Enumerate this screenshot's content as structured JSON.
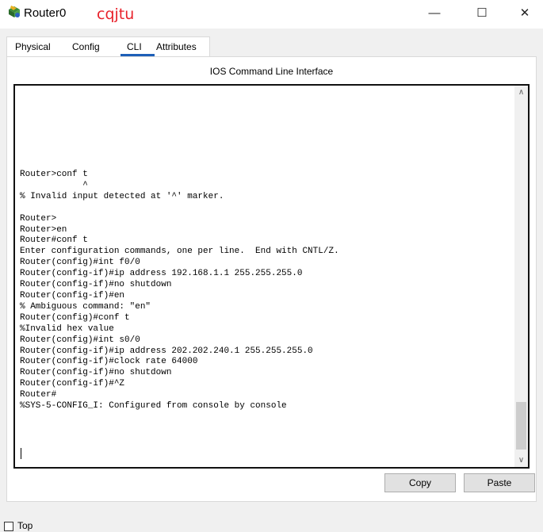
{
  "window": {
    "title": "Router0",
    "watermark": "cqjtu",
    "minimize_glyph": "—",
    "maximize_glyph": "☐",
    "close_glyph": "✕"
  },
  "tabs": [
    {
      "label": "Physical",
      "active": false
    },
    {
      "label": "Config",
      "active": false
    },
    {
      "label": "CLI",
      "active": true
    },
    {
      "label": "Attributes",
      "active": false
    }
  ],
  "cli": {
    "header": "IOS Command Line Interface",
    "output": "Router>conf t\n            ^\n% Invalid input detected at '^' marker.\n\nRouter>\nRouter>en\nRouter#conf t\nEnter configuration commands, one per line.  End with CNTL/Z.\nRouter(config)#int f0/0\nRouter(config-if)#ip address 192.168.1.1 255.255.255.0\nRouter(config-if)#no shutdown\nRouter(config-if)#en\n% Ambiguous command: \"en\"\nRouter(config)#conf t\n%Invalid hex value\nRouter(config)#int s0/0\nRouter(config-if)#ip address 202.202.240.1 255.255.255.0\nRouter(config-if)#clock rate 64000\nRouter(config-if)#no shutdown\nRouter(config-if)#^Z\nRouter#\n%SYS-5-CONFIG_I: Configured from console by console",
    "scroll_up_glyph": "∧",
    "scroll_down_glyph": "∨"
  },
  "buttons": {
    "copy": "Copy",
    "paste": "Paste"
  },
  "footer": {
    "top_label": "Top",
    "top_checked": false
  },
  "icons": {
    "app": "router-device-icon"
  }
}
